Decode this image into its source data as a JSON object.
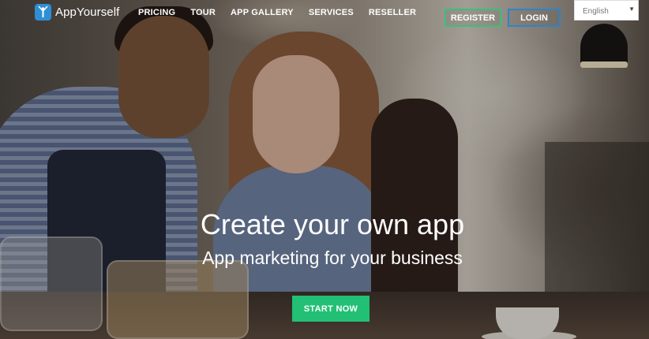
{
  "brand": {
    "name": "AppYourself",
    "icon": "person-raising-arms-icon",
    "color": "#2e8fd6"
  },
  "nav": {
    "items": [
      {
        "label": "PRICING"
      },
      {
        "label": "TOUR"
      },
      {
        "label": "APP GALLERY"
      },
      {
        "label": "SERVICES"
      },
      {
        "label": "RESELLER"
      }
    ],
    "register_label": "REGISTER",
    "login_label": "LOGIN",
    "language": {
      "selected": "English"
    }
  },
  "hero": {
    "headline": "Create your own app",
    "subheadline": "App marketing for your business",
    "cta_label": "START NOW"
  },
  "colors": {
    "register_border": "#3bbf7a",
    "login_border": "#2f84c8",
    "cta": "#22c075"
  }
}
